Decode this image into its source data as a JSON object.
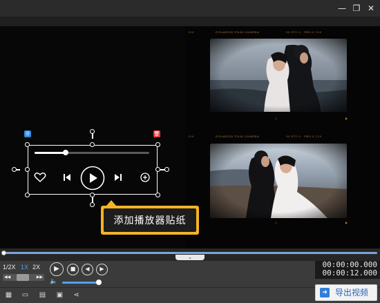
{
  "window": {
    "minimize_icon": "minimize-icon",
    "restore_icon": "restore-icon",
    "close_icon": "close-icon",
    "minimize_glyph": "—",
    "restore_glyph": "❐",
    "close_glyph": "✕"
  },
  "preview": {
    "film_top": {
      "left_label": "120",
      "center_label": "POLAROID  FILM  CAMERA",
      "right_label": "90 F11.0  ·  PRO.S 120",
      "frame_label": "2"
    },
    "film_bottom": {
      "left_label": "120",
      "center_label": "POLAROID  FILM  CAMERA",
      "right_label": "90 F11.0  ·  PRO.S 120",
      "frame_label": "2"
    }
  },
  "sticker": {
    "layer_badge_glyph": "☰",
    "delete_badge_glyph": "🗑",
    "progress": 0.27,
    "icons": [
      "heart-icon",
      "previous-icon",
      "play-icon",
      "next-icon",
      "add-icon"
    ]
  },
  "tooltip": {
    "text": "添加播放器贴纸"
  },
  "timeline": {
    "collapse_glyph": "⌄"
  },
  "controls": {
    "speeds": [
      "1/2X",
      "1X",
      "2X"
    ],
    "active_speed": "1X",
    "speed_left_glyph": "◀◀",
    "speed_right_glyph": "▶▶",
    "play_glyph": "▶",
    "stop_glyph": "■",
    "prev_glyph": "◀",
    "next_glyph": "▶",
    "volume_glyph": "🔈",
    "volume_level": 0.88,
    "current_time": "00:00:00.000",
    "total_time": "00:00:12.000"
  },
  "bottombar": {
    "icons": [
      "new-project-icon",
      "open-folder-icon",
      "save-icon",
      "save-as-icon",
      "share-icon"
    ],
    "glyphs": [
      "▦",
      "▭",
      "▤",
      "▣",
      "⋖"
    ],
    "export_label": "导出视频",
    "export_glyph": "➜"
  }
}
